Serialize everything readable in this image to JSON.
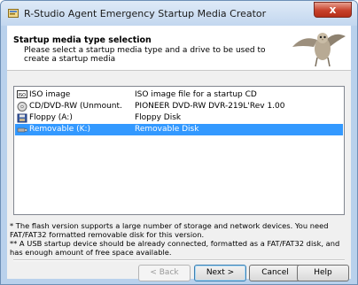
{
  "window": {
    "title": "R-Studio Agent Emergency Startup Media Creator",
    "close_label": "x"
  },
  "header": {
    "title": "Startup media type selection",
    "description": "Please select a startup media type and a drive to be used to create a startup media"
  },
  "media_list": [
    {
      "icon": "iso-image-icon",
      "name": "ISO image",
      "description": "ISO image file for a startup CD",
      "selected": false
    },
    {
      "icon": "cd-dvd-drive-icon",
      "name": "CD/DVD-RW (Unmount...",
      "description": "PIONEER DVD-RW DVR-219L'Rev 1.00",
      "selected": false
    },
    {
      "icon": "floppy-drive-icon",
      "name": "Floppy (A:)",
      "description": "Floppy Disk",
      "selected": false
    },
    {
      "icon": "usb-drive-icon",
      "name": "Removable (K:)",
      "description": "Removable Disk",
      "selected": true
    }
  ],
  "notes": {
    "line1": "* The flash version supports a large number of storage and network devices. You need FAT/FAT32 formatted removable disk for this version.",
    "line2": "** A USB startup device should be already connected, formatted as a FAT/FAT32 disk, and has enough amount of free space available."
  },
  "buttons": {
    "back": "< Back",
    "next": "Next >",
    "cancel": "Cancel",
    "help": "Help"
  },
  "colors": {
    "selection": "#3399ff",
    "close_button": "#c7412b",
    "frame": "#b9d1ec"
  }
}
